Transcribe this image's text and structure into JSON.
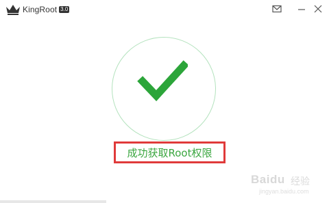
{
  "app": {
    "name": "KingRoot",
    "version": "3.0"
  },
  "window_controls": {
    "mail_icon": "mail-icon",
    "minimize_icon": "minimize-icon",
    "close_icon": "close-icon"
  },
  "result": {
    "icon": "checkmark-icon",
    "status_text": "成功获取Root权限"
  },
  "watermark": {
    "logo": "Baidu",
    "subtitle": "经验",
    "url": "jingyan.baidu.com"
  },
  "colors": {
    "accent_green": "#2ca53a",
    "ring_green": "#b3e2bd",
    "highlight_red": "#e03a3a"
  }
}
